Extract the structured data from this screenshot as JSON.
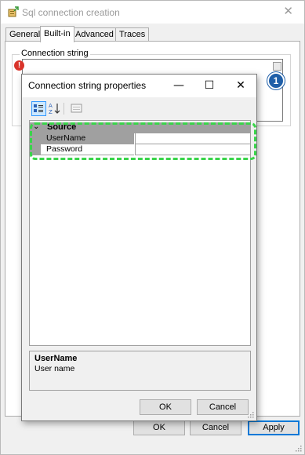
{
  "outer_window": {
    "title": "Sql connection creation",
    "close_symbol": "✕",
    "tabs": [
      "General",
      "Built-in",
      "Advanced",
      "Traces"
    ],
    "active_tab": "Built-in",
    "group_label": "Connection string",
    "error_symbol": "!",
    "buttons": {
      "ok": "OK",
      "cancel": "Cancel",
      "apply": "Apply"
    }
  },
  "callout": {
    "number": "1",
    "color": "#1f5fa8"
  },
  "dialog": {
    "title": "Connection string properties",
    "minimize_symbol": "—",
    "maximize_symbol": "☐",
    "close_symbol": "✕",
    "toolbar_icons": [
      "categorized-icon",
      "alphabetical-icon",
      "property-pages-icon"
    ],
    "property_grid": {
      "category": {
        "label": "Source",
        "expanded": true
      },
      "properties": [
        {
          "name": "UserName",
          "value": "",
          "selected": true
        },
        {
          "name": "Password",
          "value": "",
          "selected": false
        }
      ]
    },
    "description": {
      "title": "UserName",
      "text": "User name"
    },
    "buttons": {
      "ok": "OK",
      "cancel": "Cancel"
    }
  },
  "colors": {
    "highlight": "#39d44a",
    "accent": "#0078d7",
    "selection_gray": "#a0a0a0"
  }
}
